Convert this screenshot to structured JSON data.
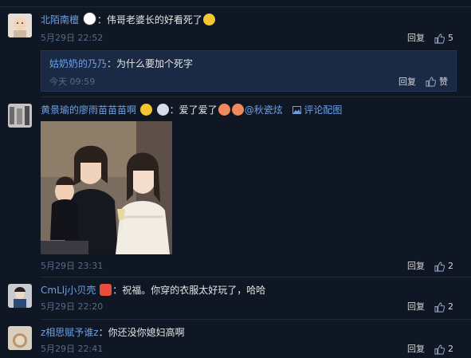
{
  "comments": [
    {
      "username": "北陌南檀",
      "text_a": "：伟哥老婆长的好看死了",
      "time": "5月29日 22:52",
      "reply_label": "回复",
      "like_count": "5"
    },
    {
      "username": "黄景瑜的廖雨苗苗苗啊",
      "text_a": "：爱了爱了",
      "mention": "@秋瓷炫",
      "pic_link": "评论配图",
      "time": "5月29日 23:31",
      "reply_label": "回复",
      "like_count": "2"
    },
    {
      "username": "CmLlj小贝壳",
      "text_a": "：祝福。你穿的衣服太好玩了，哈哈",
      "time": "5月29日 22:20",
      "reply_label": "回复",
      "like_count": "2"
    },
    {
      "username": "z相思赋予谁z",
      "text_a": "：你还没你媳妇高啊",
      "time": "5月29日 22:41",
      "reply_label": "回复",
      "like_count": "2"
    }
  ],
  "sub_reply": {
    "username": "姑奶奶的乃乃",
    "text": "：为什么要加个死字",
    "time": "今天 09:59",
    "reply_label": "回复",
    "like_label": "赞"
  },
  "colors": {
    "background": "#0f1724",
    "username": "#6ea0e6",
    "meta": "#566a8a",
    "reply_box": "#1a2a45"
  },
  "icons": [
    "thumbs-up-icon",
    "panda-emoji-icon",
    "laugh-emoji-icon",
    "grin-emoji-icon",
    "diamond-ring-icon",
    "kiss-emoji-icon",
    "image-icon",
    "fire-heart-icon"
  ]
}
